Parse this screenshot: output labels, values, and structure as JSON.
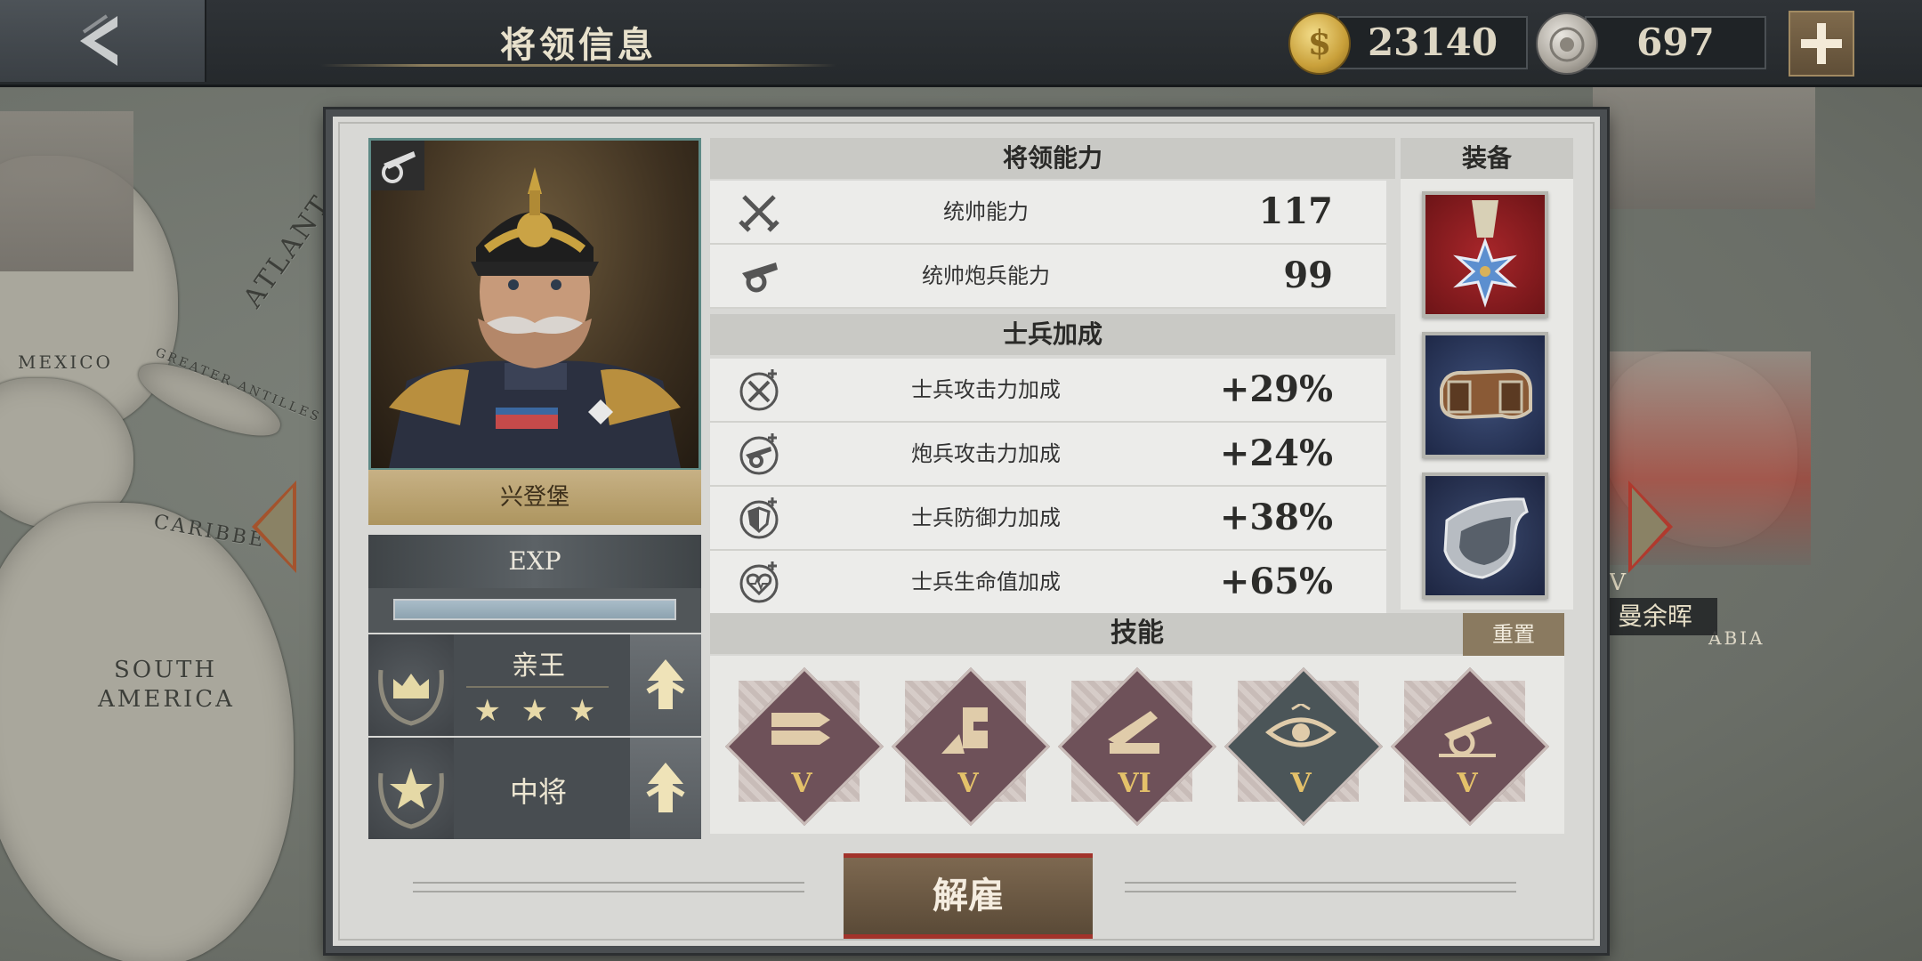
{
  "header": {
    "title": "将领信息",
    "gold": "23140",
    "medals": "697"
  },
  "colors": {
    "panel_bg": "#d8d8d5",
    "accent_gold": "#ad955f",
    "exp_fill": "#8da3b0",
    "danger_red": "#a2332b",
    "skill_level": "#e4c16a"
  },
  "general": {
    "name": "兴登堡",
    "exp_label": "EXP",
    "exp_progress": 1.0,
    "title_rank": "亲王",
    "title_stars": "★ ★ ★",
    "military_rank": "中将"
  },
  "abilities": {
    "header": "将领能力",
    "rows": [
      {
        "icon": "crossed-swords-icon",
        "label": "统帅能力",
        "value": "117"
      },
      {
        "icon": "cannon-icon",
        "label": "统帅炮兵能力",
        "value": "99"
      }
    ]
  },
  "bonuses": {
    "header": "士兵加成",
    "rows": [
      {
        "icon": "attack-bonus-icon",
        "label": "士兵攻击力加成",
        "value": "+29%"
      },
      {
        "icon": "artillery-bonus-icon",
        "label": "炮兵攻击力加成",
        "value": "+24%"
      },
      {
        "icon": "defense-bonus-icon",
        "label": "士兵防御力加成",
        "value": "+38%"
      },
      {
        "icon": "health-bonus-icon",
        "label": "士兵生命值加成",
        "value": "+65%"
      }
    ]
  },
  "equipment": {
    "header": "装备",
    "items": [
      {
        "icon": "medal-icon"
      },
      {
        "icon": "ammo-belt-icon"
      },
      {
        "icon": "armor-plate-icon"
      }
    ]
  },
  "skills": {
    "header": "技能",
    "reset_label": "重置",
    "items": [
      {
        "icon": "arrows-skill-icon",
        "level": "V"
      },
      {
        "icon": "fortify-skill-icon",
        "level": "V"
      },
      {
        "icon": "artillery-skill-icon",
        "level": "VI"
      },
      {
        "icon": "eye-skill-icon",
        "level": "V"
      },
      {
        "icon": "cannon-skill-icon",
        "level": "V"
      }
    ]
  },
  "dismiss_label": "解雇",
  "map_labels": {
    "mexico": "MEXICO",
    "atlantic": "ATLANT",
    "caribbean": "CARIBBE",
    "antilles": "GREATER ANTILLES",
    "south_america_1": "SOUTH",
    "south_america_2": "AMERICA",
    "arabia": "ABIA"
  },
  "neighbor": {
    "roman": "IV",
    "name": "曼余晖"
  }
}
